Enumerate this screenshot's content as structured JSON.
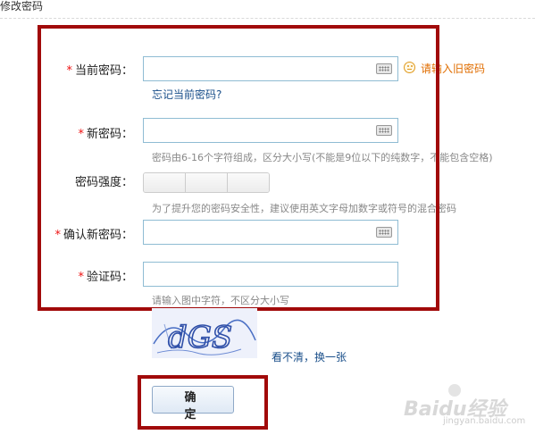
{
  "header": {
    "title": "修改密码"
  },
  "form": {
    "required_mark": "*",
    "current_password": {
      "label": "当前密码：",
      "value": "",
      "warning": "请输入旧密码",
      "forgot_link": "忘记当前密码?"
    },
    "new_password": {
      "label": "新密码：",
      "value": "",
      "hint": "密码由6-16个字符组成，区分大小写(不能是9位以下的纯数字，不能包含空格)"
    },
    "strength": {
      "label": "密码强度：",
      "hint": "为了提升您的密码安全性，建议使用英文字母加数字或符号的混合密码"
    },
    "confirm_password": {
      "label": "确认新密码：",
      "value": ""
    },
    "captcha": {
      "label": "验证码：",
      "value": "",
      "hint": "请输入图中字符，不区分大小写",
      "image_text": "dGS",
      "refresh_link": "看不清，换一张"
    },
    "submit_label": "确 定"
  },
  "watermark": {
    "brand": "Baidu经验",
    "sub": "jingyan.baidu.com"
  },
  "colors": {
    "highlight": "#a10a0a",
    "required": "#e11111",
    "link": "#1a4f8a",
    "warning": "#e06d00",
    "field_border": "#8fbcd3"
  },
  "icons": [
    "keyboard-icon",
    "warning-face-icon"
  ]
}
